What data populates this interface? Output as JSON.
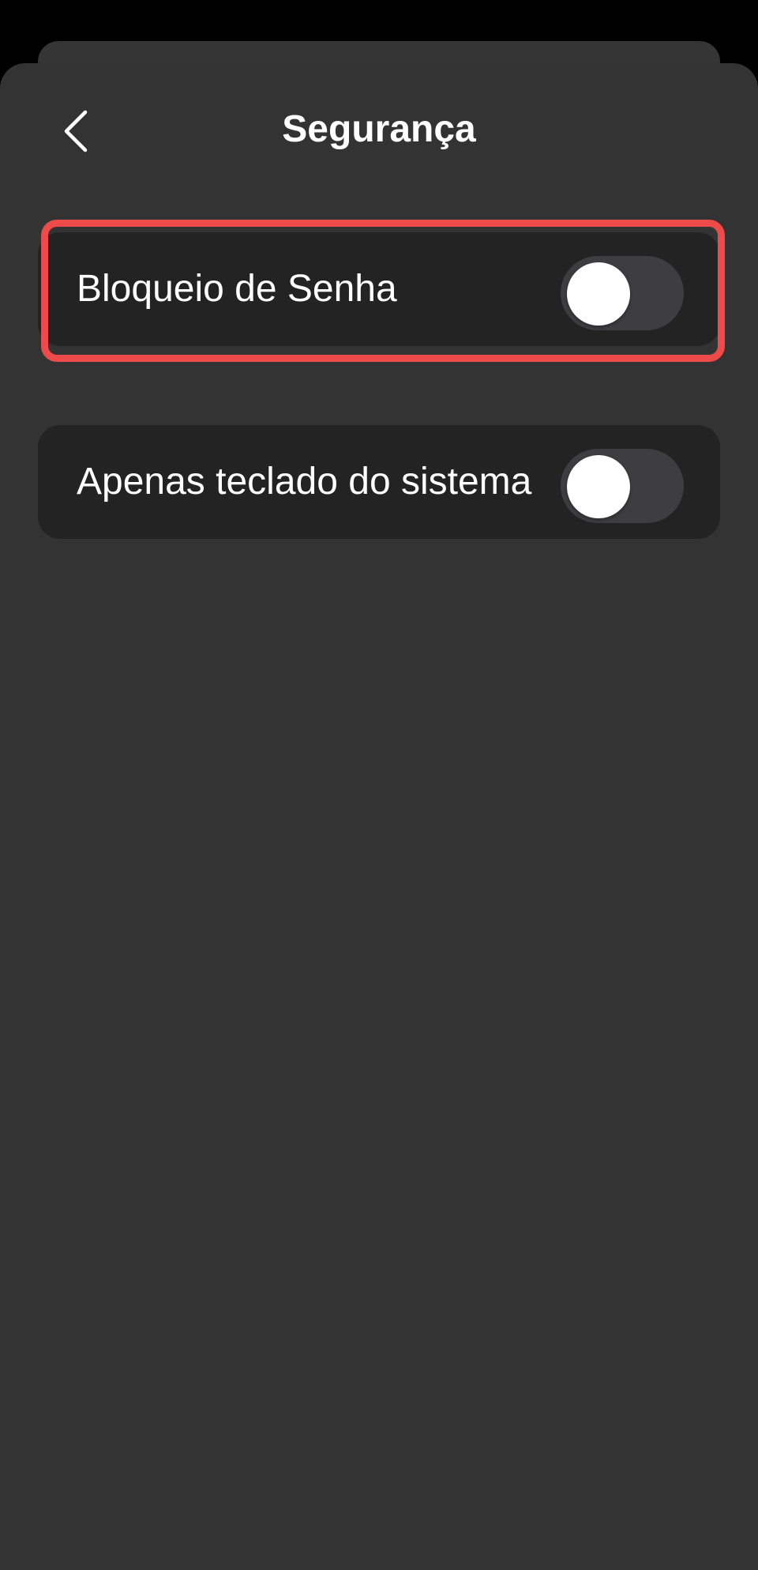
{
  "header": {
    "title": "Segurança",
    "back_icon": "chevron-left-icon"
  },
  "settings": [
    {
      "label": "Bloqueio de Senha",
      "enabled": false,
      "highlighted": true
    },
    {
      "label": "Apenas teclado do sistema",
      "enabled": false,
      "highlighted": false
    }
  ],
  "colors": {
    "background": "#000000",
    "sheet": "#333333",
    "row": "#232323",
    "toggle_off_track": "#3e3e41",
    "toggle_knob": "#ffffff",
    "highlight": "#ee4a4a",
    "text": "#ffffff"
  }
}
